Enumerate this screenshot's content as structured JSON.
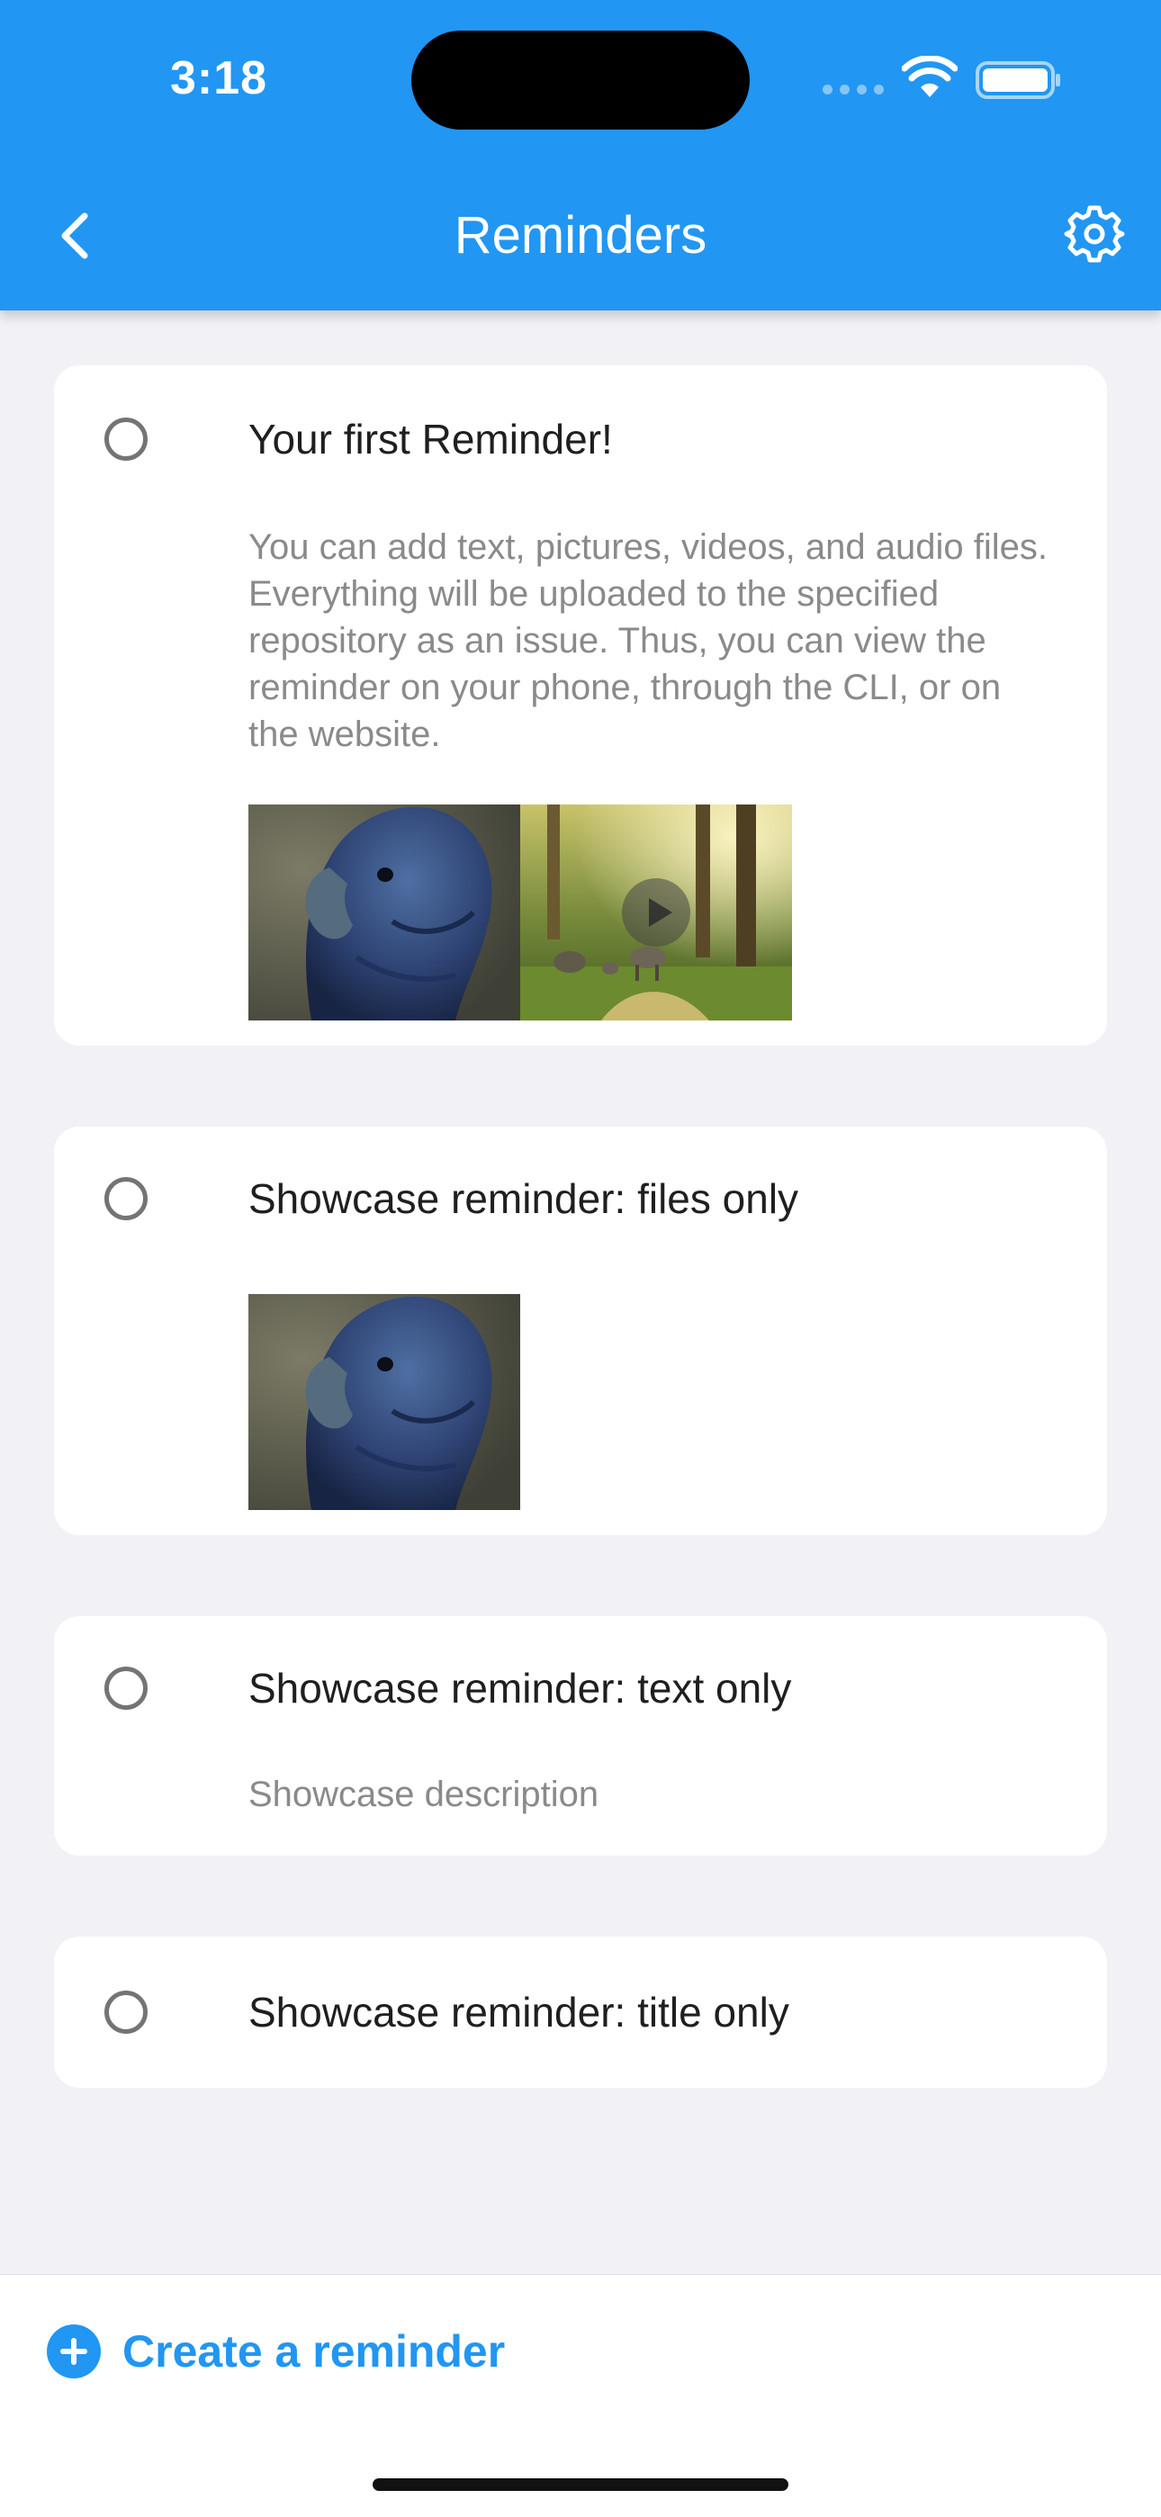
{
  "status_bar": {
    "time": "3:18",
    "icons": [
      "cellular-signal-icon",
      "wifi-icon",
      "battery-icon"
    ]
  },
  "header": {
    "title": "Reminders",
    "back_icon": "chevron-left-icon",
    "settings_icon": "gear-icon"
  },
  "reminders": [
    {
      "title": "Your first Reminder!",
      "description": "You can add text, pictures, videos, and audio files. Everything will be uploaded to the specified repository as an issue. Thus, you can view the reminder on your phone, through the CLI, or on the website.",
      "attachments": [
        "image",
        "video"
      ]
    },
    {
      "title": "Showcase reminder: files only",
      "description": "",
      "attachments": [
        "image"
      ]
    },
    {
      "title": "Showcase reminder: text only",
      "description": "Showcase description",
      "attachments": []
    },
    {
      "title": "Showcase reminder: title only",
      "description": "",
      "attachments": []
    }
  ],
  "footer": {
    "create_label": "Create a reminder",
    "create_icon": "plus-circle-icon"
  },
  "colors": {
    "accent": "#2196f3",
    "background": "#f1f1f6",
    "card": "#ffffff",
    "title_text": "#1f1f1f",
    "description_text": "#8a8a8a"
  }
}
